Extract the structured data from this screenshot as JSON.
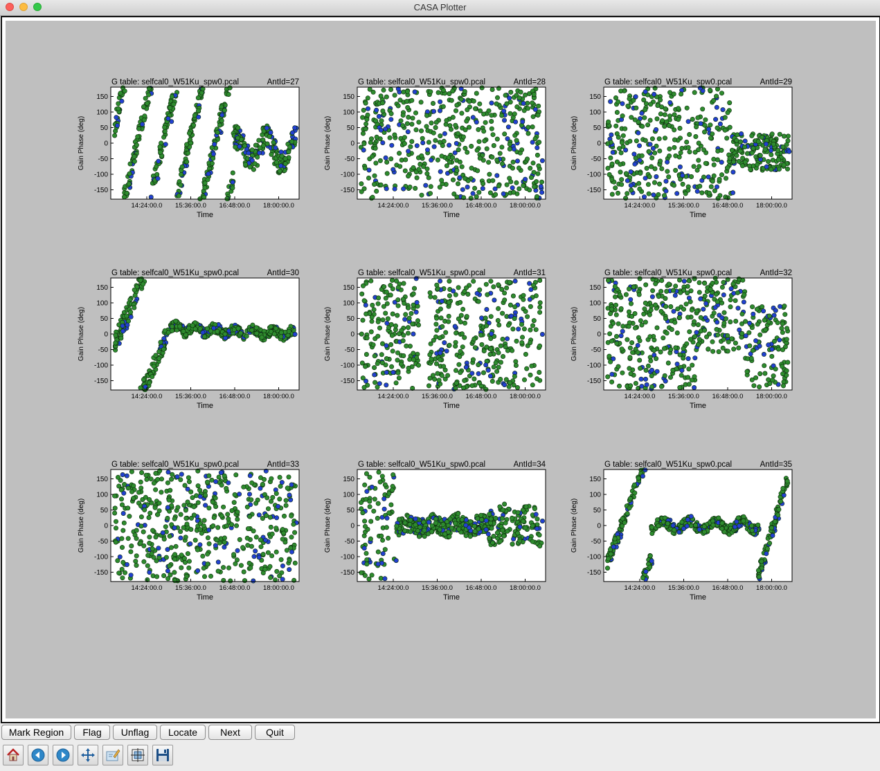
{
  "window": {
    "title": "CASA Plotter"
  },
  "buttons": {
    "mark_region": "Mark Region",
    "flag": "Flag",
    "unflag": "Unflag",
    "locate": "Locate",
    "next": "Next",
    "quit": "Quit"
  },
  "toolbar_icons": [
    "home-icon",
    "back-arrow-icon",
    "forward-arrow-icon",
    "pan-move-icon",
    "edit-axis-icon",
    "subplots-configure-icon",
    "save-disk-icon"
  ],
  "colors": {
    "canvas_bg": "#bfbfbf",
    "point_green": "#2e8b2e",
    "point_blue": "#2240d0"
  },
  "chart_data": [
    {
      "type": "scatter",
      "title": "G table: selfcal0_W51Ku_spw0.pcal",
      "ant_label": "AntId=27",
      "xlabel": "Time",
      "ylabel": "Gain Phase (deg)",
      "xticks": [
        "14:24:00.0",
        "15:36:00.0",
        "16:48:00.0",
        "18:00:00.0"
      ],
      "yticks": [
        150,
        100,
        50,
        0,
        -50,
        -100,
        -150
      ],
      "ylim": [
        -180,
        180
      ],
      "pattern": "wraps"
    },
    {
      "type": "scatter",
      "title": "G table: selfcal0_W51Ku_spw0.pcal",
      "ant_label": "AntId=28",
      "xlabel": "Time",
      "ylabel": "Gain Phase (deg)",
      "xticks": [
        "14:24:00.0",
        "15:36:00.0",
        "16:48:00.0",
        "18:00:00.0"
      ],
      "yticks": [
        150,
        100,
        50,
        0,
        -50,
        -100,
        -150
      ],
      "ylim": [
        -180,
        180
      ],
      "pattern": "full"
    },
    {
      "type": "scatter",
      "title": "G table: selfcal0_W51Ku_spw0.pcal",
      "ant_label": "AntId=29",
      "xlabel": "Time",
      "ylabel": "Gain Phase (deg)",
      "xticks": [
        "14:24:00.0",
        "15:36:00.0",
        "16:48:00.0",
        "18:00:00.0"
      ],
      "yticks": [
        150,
        100,
        50,
        0,
        -50,
        -100,
        -150
      ],
      "ylim": [
        -180,
        180
      ],
      "pattern": "full_then_band"
    },
    {
      "type": "scatter",
      "title": "G table: selfcal0_W51Ku_spw0.pcal",
      "ant_label": "AntId=30",
      "xlabel": "Time",
      "ylabel": "Gain Phase (deg)",
      "xticks": [
        "14:24:00.0",
        "15:36:00.0",
        "16:48:00.0",
        "18:00:00.0"
      ],
      "yticks": [
        150,
        100,
        50,
        0,
        -50,
        -100,
        -150
      ],
      "ylim": [
        -180,
        180
      ],
      "pattern": "wave"
    },
    {
      "type": "scatter",
      "title": "G table: selfcal0_W51Ku_spw0.pcal",
      "ant_label": "AntId=31",
      "xlabel": "Time",
      "ylabel": "Gain Phase (deg)",
      "xticks": [
        "14:24:00.0",
        "15:36:00.0",
        "16:48:00.0",
        "18:00:00.0"
      ],
      "yticks": [
        150,
        100,
        50,
        0,
        -50,
        -100,
        -150
      ],
      "ylim": [
        -180,
        180
      ],
      "pattern": "full_gap"
    },
    {
      "type": "scatter",
      "title": "G table: selfcal0_W51Ku_spw0.pcal",
      "ant_label": "AntId=32",
      "xlabel": "Time",
      "ylabel": "Gain Phase (deg)",
      "xticks": [
        "14:24:00.0",
        "15:36:00.0",
        "16:48:00.0",
        "18:00:00.0"
      ],
      "yticks": [
        150,
        100,
        50,
        0,
        -50,
        -100,
        -150
      ],
      "ylim": [
        -180,
        180
      ],
      "pattern": "mixed"
    },
    {
      "type": "scatter",
      "title": "G table: selfcal0_W51Ku_spw0.pcal",
      "ant_label": "AntId=33",
      "xlabel": "Time",
      "ylabel": "Gain Phase (deg)",
      "xticks": [
        "14:24:00.0",
        "15:36:00.0",
        "16:48:00.0",
        "18:00:00.0"
      ],
      "yticks": [
        150,
        100,
        50,
        0,
        -50,
        -100,
        -150
      ],
      "ylim": [
        -180,
        180
      ],
      "pattern": "full"
    },
    {
      "type": "scatter",
      "title": "G table: selfcal0_W51Ku_spw0.pcal",
      "ant_label": "AntId=34",
      "xlabel": "Time",
      "ylabel": "Gain Phase (deg)",
      "xticks": [
        "14:24:00.0",
        "15:36:00.0",
        "16:48:00.0",
        "18:00:00.0"
      ],
      "yticks": [
        150,
        100,
        50,
        0,
        -50,
        -100,
        -150
      ],
      "ylim": [
        -180,
        180
      ],
      "pattern": "full_then_wave"
    },
    {
      "type": "scatter",
      "title": "G table: selfcal0_W51Ku_spw0.pcal",
      "ant_label": "AntId=35",
      "xlabel": "Time",
      "ylabel": "Gain Phase (deg)",
      "xticks": [
        "14:24:00.0",
        "15:36:00.0",
        "16:48:00.0",
        "18:00:00.0"
      ],
      "yticks": [
        150,
        100,
        50,
        0,
        -50,
        -100,
        -150
      ],
      "ylim": [
        -180,
        180
      ],
      "pattern": "wave_wraps"
    }
  ]
}
